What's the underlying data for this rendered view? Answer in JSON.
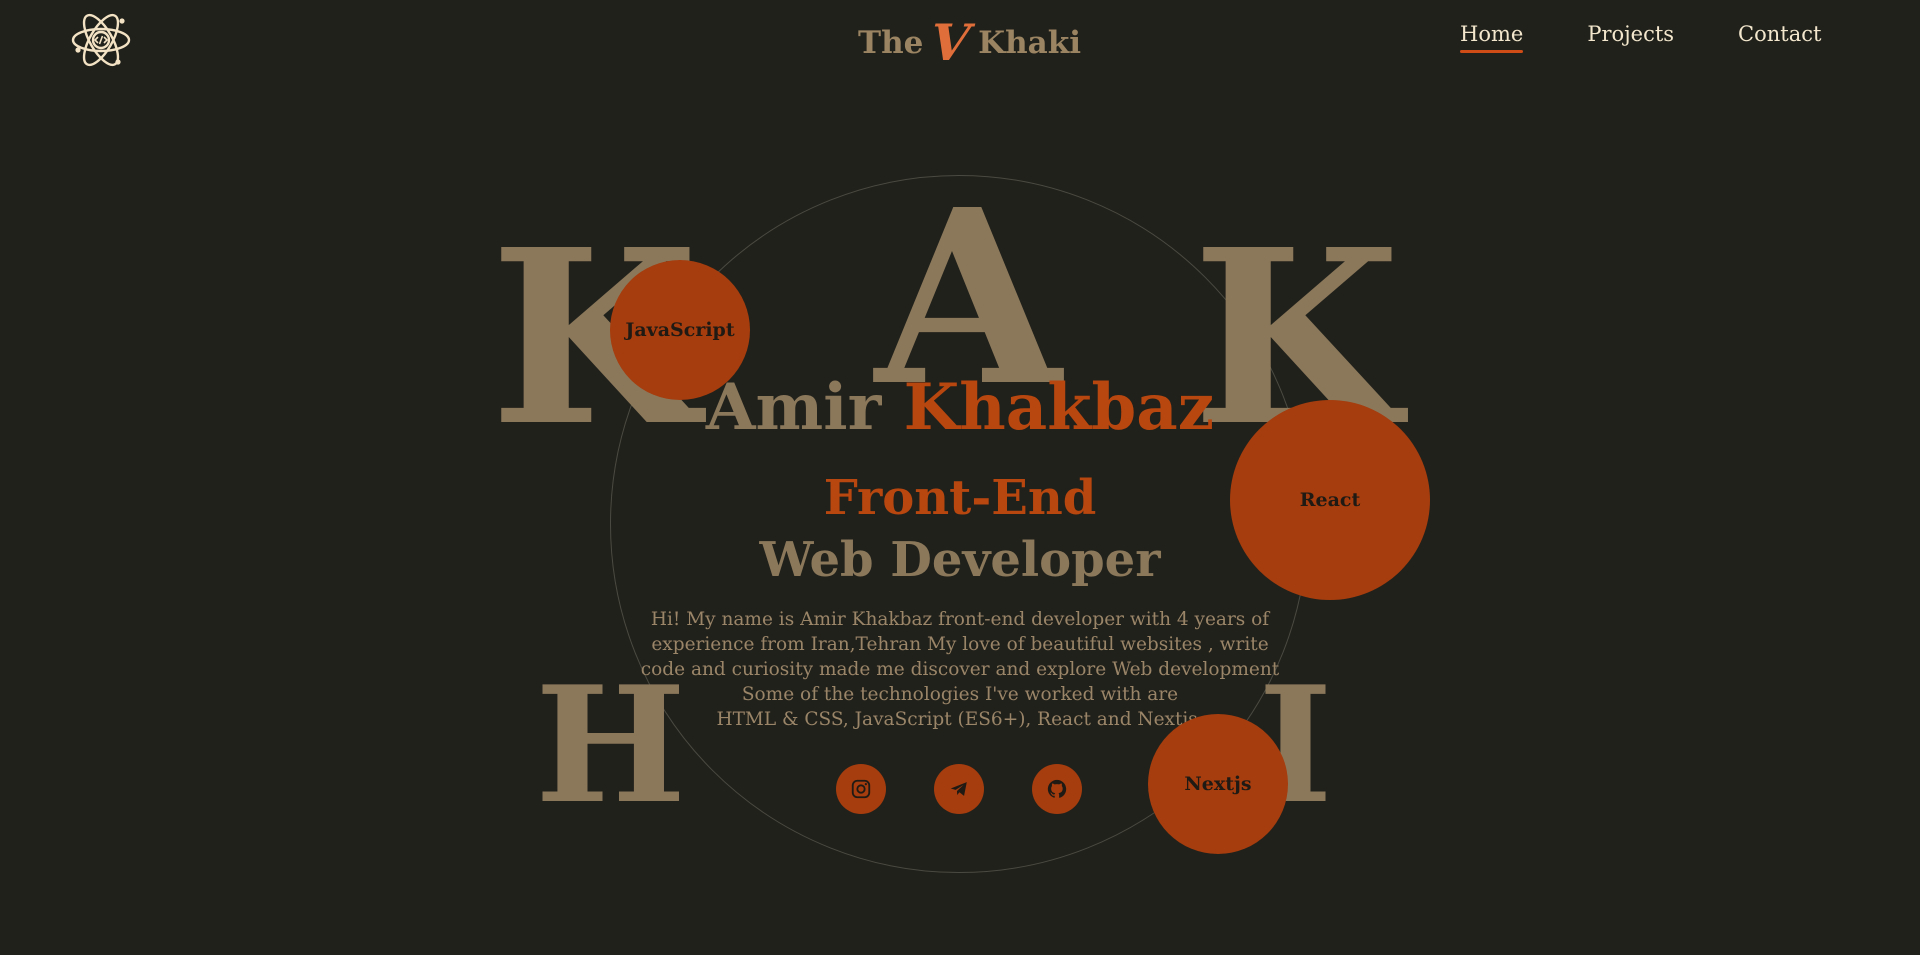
{
  "header": {
    "brand": {
      "the": "The",
      "v": "V",
      "khaki": "Khaki"
    },
    "nav": [
      {
        "label": "Home",
        "active": true
      },
      {
        "label": "Projects",
        "active": false
      },
      {
        "label": "Contact",
        "active": false
      }
    ]
  },
  "hero": {
    "letters": {
      "k1": "K",
      "a": "A",
      "k2": "K",
      "h": "H",
      "i": "I"
    },
    "skills": {
      "js": "JavaScript",
      "react": "React",
      "next": "Nextjs"
    },
    "first_name": "Amir",
    "last_name": "Khakbaz",
    "role_line1": "Front-End",
    "role_line2": "Web Developer",
    "bio": [
      "Hi! My name is Amir Khakbaz front-end developer with 4 years of",
      "experience from Iran,Tehran My love of beautiful websites , write",
      "code and curiosity made me discover and explore Web development",
      "Some of the technologies I've worked with are",
      "HTML & CSS, JavaScript (ES6+), React and Nextjs."
    ],
    "socials": [
      "instagram-icon",
      "telegram-icon",
      "github-icon"
    ]
  },
  "colors": {
    "background": "#21211b",
    "accent": "#b8460f",
    "bubble": "#a53d0e",
    "khaki": "#8b785b",
    "nav_text": "#f3e7cd"
  }
}
